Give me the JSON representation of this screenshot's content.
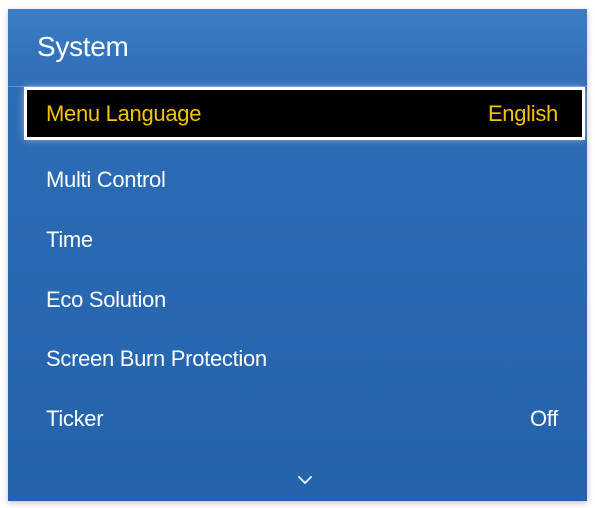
{
  "window": {
    "title": "System"
  },
  "menu": {
    "items": [
      {
        "label": "Menu Language",
        "value": "English",
        "selected": true
      },
      {
        "label": "Multi Control",
        "value": ""
      },
      {
        "label": "Time",
        "value": ""
      },
      {
        "label": "Eco Solution",
        "value": ""
      },
      {
        "label": "Screen Burn Protection",
        "value": ""
      },
      {
        "label": "Ticker",
        "value": "Off"
      }
    ]
  },
  "icons": {
    "scroll_down": "chevron-down-icon"
  },
  "colors": {
    "panel": "#2a69b3",
    "selected_background": "#000000",
    "selected_text": "#f6c20a",
    "text": "#ffffff"
  }
}
